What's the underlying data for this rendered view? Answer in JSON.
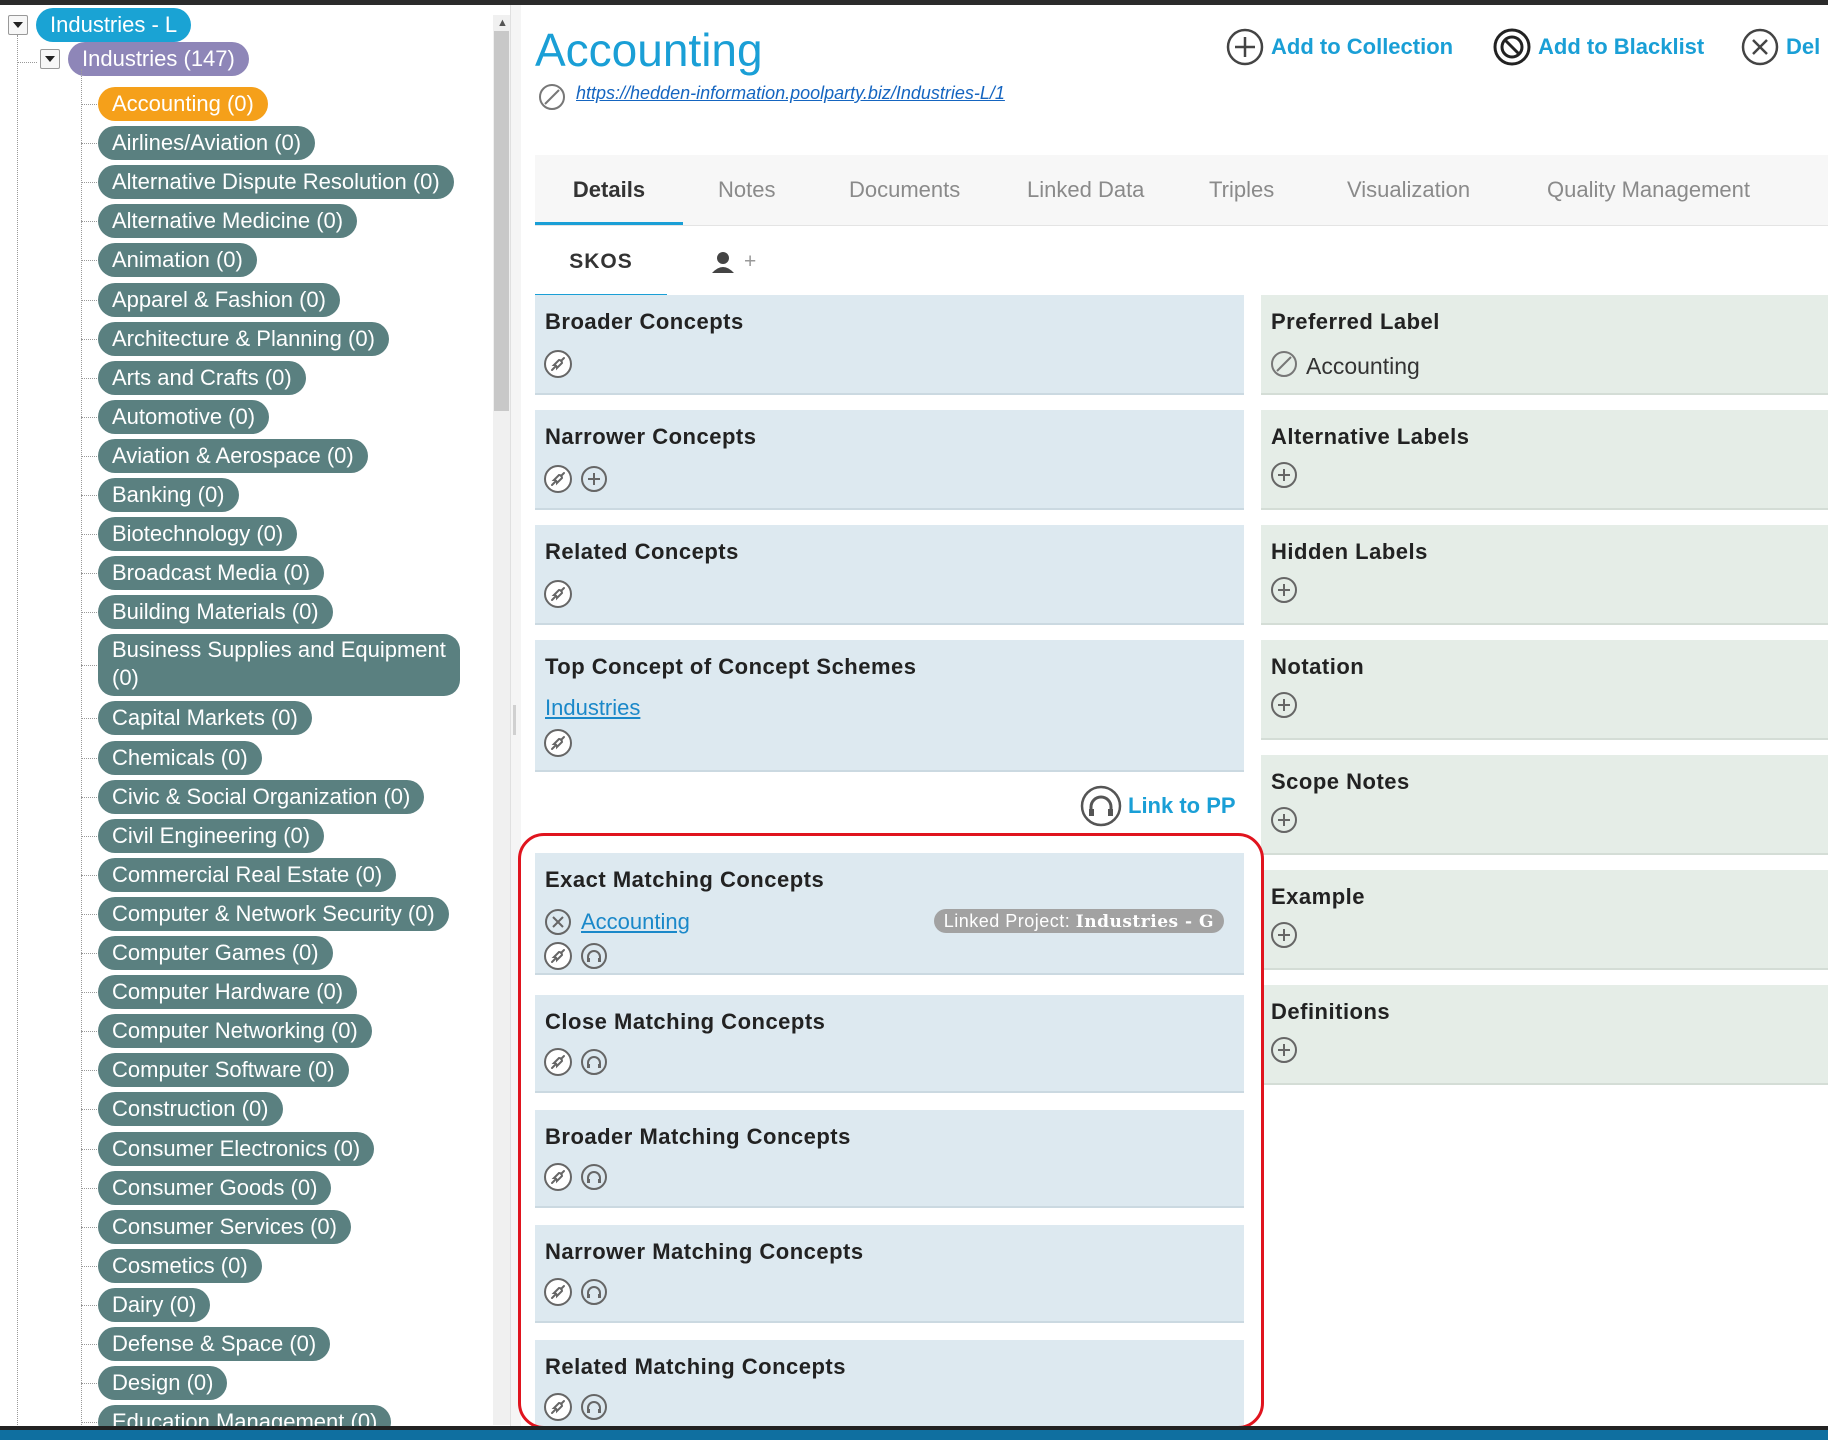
{
  "tree": {
    "root_label": "Industries - L",
    "scheme_label": "Industries (147)",
    "items": [
      {
        "label": "Accounting (0)",
        "selected": true
      },
      {
        "label": "Airlines/Aviation (0)"
      },
      {
        "label": "Alternative Dispute Resolution (0)"
      },
      {
        "label": "Alternative Medicine (0)"
      },
      {
        "label": "Animation (0)"
      },
      {
        "label": "Apparel & Fashion (0)"
      },
      {
        "label": "Architecture & Planning (0)"
      },
      {
        "label": "Arts and Crafts (0)"
      },
      {
        "label": "Automotive (0)"
      },
      {
        "label": "Aviation & Aerospace (0)"
      },
      {
        "label": "Banking (0)"
      },
      {
        "label": "Biotechnology (0)"
      },
      {
        "label": "Broadcast Media (0)"
      },
      {
        "label": "Building Materials (0)"
      },
      {
        "label": "Business Supplies and Equipment (0)",
        "wrapped": true
      },
      {
        "label": "Capital Markets (0)"
      },
      {
        "label": "Chemicals (0)"
      },
      {
        "label": "Civic & Social Organization (0)"
      },
      {
        "label": "Civil Engineering (0)"
      },
      {
        "label": "Commercial Real Estate (0)"
      },
      {
        "label": "Computer & Network Security (0)"
      },
      {
        "label": "Computer Games (0)"
      },
      {
        "label": "Computer Hardware (0)"
      },
      {
        "label": "Computer Networking (0)"
      },
      {
        "label": "Computer Software (0)"
      },
      {
        "label": "Construction (0)"
      },
      {
        "label": "Consumer Electronics (0)"
      },
      {
        "label": "Consumer Goods (0)"
      },
      {
        "label": "Consumer Services (0)"
      },
      {
        "label": "Cosmetics (0)"
      },
      {
        "label": "Dairy (0)"
      },
      {
        "label": "Defense & Space (0)"
      },
      {
        "label": "Design (0)"
      },
      {
        "label": "Education Management (0)"
      }
    ]
  },
  "concept": {
    "title": "Accounting",
    "uri": "https://hedden-information.poolparty.biz/Industries-L/1"
  },
  "actions": {
    "add_collection": "Add to Collection",
    "add_blacklist": "Add to Blacklist",
    "delete": "Del"
  },
  "tabs": [
    "Details",
    "Notes",
    "Documents",
    "Linked Data",
    "Triples",
    "Visualization",
    "Quality Management"
  ],
  "subtabs": {
    "skos": "SKOS",
    "custom": "+"
  },
  "left_boxes": {
    "broader": "Broader Concepts",
    "narrower": "Narrower Concepts",
    "related": "Related Concepts",
    "top_concept": "Top Concept of Concept Schemes",
    "top_concept_link": "Industries"
  },
  "link_to_pp": "Link to PP",
  "matching": {
    "exact": "Exact Matching Concepts",
    "exact_link": "Accounting",
    "linked_project_prefix": "Linked Project:",
    "linked_project_name": "Industries - G",
    "close": "Close Matching Concepts",
    "broader": "Broader Matching Concepts",
    "narrower": "Narrower Matching Concepts",
    "related": "Related Matching Concepts"
  },
  "right_boxes": {
    "preferred": "Preferred Label",
    "preferred_value": "Accounting",
    "alternative": "Alternative Labels",
    "hidden": "Hidden Labels",
    "notation": "Notation",
    "scope": "Scope Notes",
    "example": "Example",
    "definitions": "Definitions"
  },
  "colors": {
    "accent": "#1a9fd6",
    "selected": "#f5a01a",
    "pill": "#5a8080",
    "highlight_frame": "#e0141e"
  }
}
